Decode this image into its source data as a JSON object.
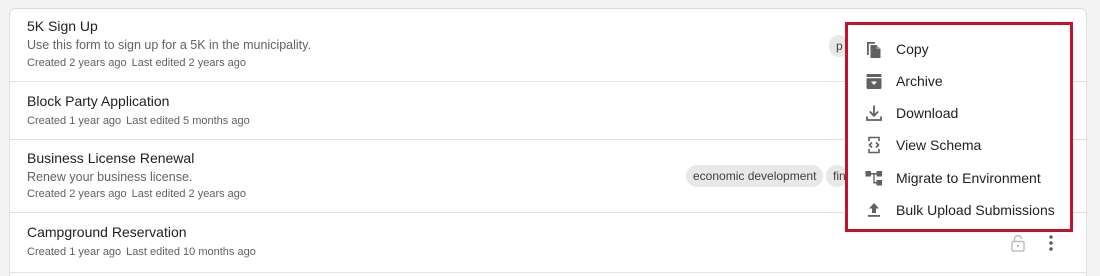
{
  "rows": [
    {
      "title": "5K Sign Up",
      "description": "Use this form to sign up for a 5K in the municipality.",
      "created": "Created 2 years ago",
      "edited": "Last edited 2 years ago",
      "tags": [
        "p"
      ]
    },
    {
      "title": "Block Party Application",
      "created": "Created 1 year ago",
      "edited": "Last edited 5 months ago"
    },
    {
      "title": "Business License Renewal",
      "description": "Renew your business license.",
      "created": "Created 2 years ago",
      "edited": "Last edited 2 years ago",
      "tags": [
        "economic development",
        "fin"
      ]
    },
    {
      "title": "Campground Reservation",
      "created": "Created 1 year ago",
      "edited": "Last edited 10 months ago"
    }
  ],
  "menu": {
    "items": [
      {
        "label": "Copy",
        "icon": "copy-icon"
      },
      {
        "label": "Archive",
        "icon": "archive-icon"
      },
      {
        "label": "Download",
        "icon": "download-icon"
      },
      {
        "label": "View Schema",
        "icon": "view-schema-icon"
      },
      {
        "label": "Migrate to Environment",
        "icon": "migrate-icon"
      },
      {
        "label": "Bulk Upload Submissions",
        "icon": "upload-icon"
      }
    ],
    "highlight_color": "#c3122e"
  }
}
